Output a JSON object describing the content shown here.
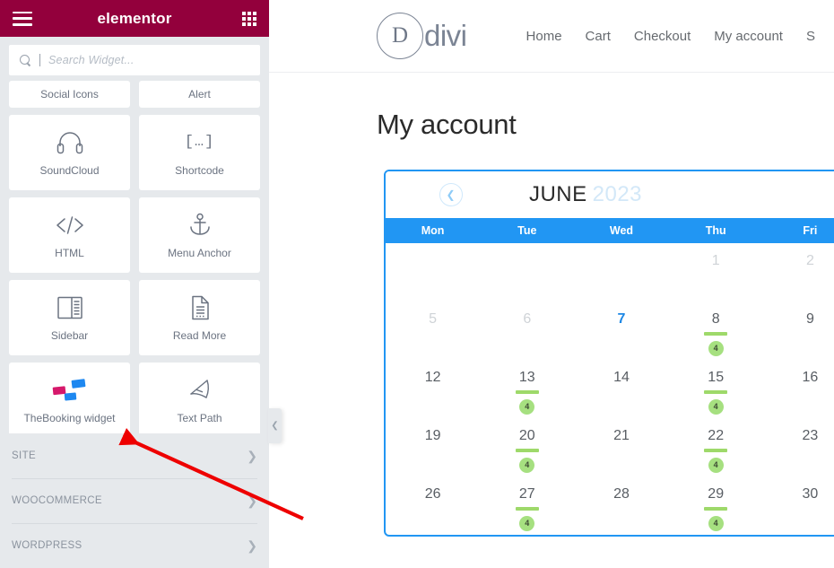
{
  "panel": {
    "brand": "elementor",
    "menu_icon": "hamburger-icon",
    "apps_icon": "grid-apps-icon",
    "search": {
      "placeholder": "Search Widget...",
      "value": "",
      "icon": "search-icon"
    },
    "widgets": [
      {
        "label": "Social Icons",
        "icon": "social-icons-icon",
        "partial": true
      },
      {
        "label": "Alert",
        "icon": "alert-icon",
        "partial": true
      },
      {
        "label": "SoundCloud",
        "icon": "headphones-icon",
        "partial": false
      },
      {
        "label": "Shortcode",
        "icon": "shortcode-brackets-icon",
        "partial": false
      },
      {
        "label": "HTML",
        "icon": "code-tags-icon",
        "partial": false
      },
      {
        "label": "Menu Anchor",
        "icon": "anchor-icon",
        "partial": false
      },
      {
        "label": "Sidebar",
        "icon": "sidebar-layout-icon",
        "partial": false
      },
      {
        "label": "Read More",
        "icon": "document-icon",
        "partial": false
      },
      {
        "label": "TheBooking widget",
        "icon": "thebooking-flags-icon",
        "partial": false
      },
      {
        "label": "Text Path",
        "icon": "text-path-icon",
        "partial": false
      }
    ],
    "sections": [
      {
        "label": "SITE",
        "chevron": "chevron-right-icon"
      },
      {
        "label": "WOOCOMMERCE",
        "chevron": "chevron-right-icon"
      },
      {
        "label": "WORDPRESS",
        "chevron": "chevron-right-icon"
      }
    ],
    "collapse_handle_icon": "chevron-left-icon",
    "colors": {
      "header_bg": "#93003c",
      "panel_bg": "#e6e9ec"
    }
  },
  "site": {
    "logo": {
      "mark": "D",
      "text": "divi"
    },
    "nav": [
      {
        "label": "Home"
      },
      {
        "label": "Cart"
      },
      {
        "label": "Checkout"
      },
      {
        "label": "My account"
      },
      {
        "label": "S"
      }
    ],
    "page_title": "My account"
  },
  "calendar": {
    "prev_icon": "chevron-left-circle-icon",
    "month": "JUNE",
    "year": "2023",
    "weekdays": [
      "Mon",
      "Tue",
      "Wed",
      "Thu",
      "Fri"
    ],
    "cells": [
      {
        "num": "",
        "state": "empty"
      },
      {
        "num": "",
        "state": "empty"
      },
      {
        "num": "",
        "state": "empty"
      },
      {
        "num": "1",
        "state": "disabled"
      },
      {
        "num": "2",
        "state": "disabled"
      },
      {
        "num": "5",
        "state": "disabled"
      },
      {
        "num": "6",
        "state": "disabled"
      },
      {
        "num": "7",
        "state": "today"
      },
      {
        "num": "8",
        "state": "available",
        "badge": "4"
      },
      {
        "num": "9",
        "state": "normal"
      },
      {
        "num": "12",
        "state": "normal"
      },
      {
        "num": "13",
        "state": "available",
        "badge": "4"
      },
      {
        "num": "14",
        "state": "normal"
      },
      {
        "num": "15",
        "state": "available",
        "badge": "4"
      },
      {
        "num": "16",
        "state": "normal"
      },
      {
        "num": "19",
        "state": "normal"
      },
      {
        "num": "20",
        "state": "available",
        "badge": "4"
      },
      {
        "num": "21",
        "state": "normal"
      },
      {
        "num": "22",
        "state": "available",
        "badge": "4"
      },
      {
        "num": "23",
        "state": "normal"
      },
      {
        "num": "26",
        "state": "normal"
      },
      {
        "num": "27",
        "state": "available",
        "badge": "4"
      },
      {
        "num": "28",
        "state": "normal"
      },
      {
        "num": "29",
        "state": "available",
        "badge": "4"
      },
      {
        "num": "30",
        "state": "normal"
      }
    ],
    "colors": {
      "accent": "#2196f3",
      "badge": "#a6e080",
      "bar": "#9ed96a"
    }
  },
  "annotation": {
    "arrow_color": "#ee0000"
  }
}
